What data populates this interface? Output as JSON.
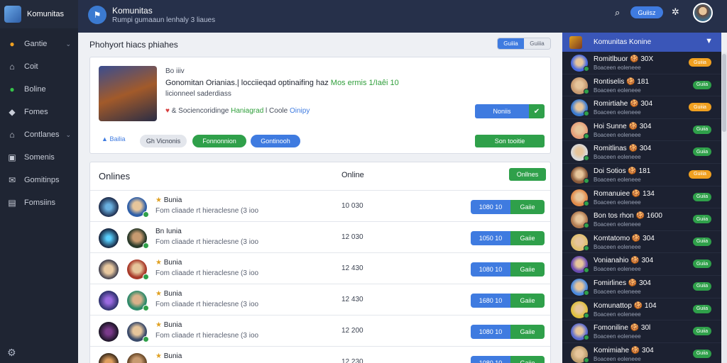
{
  "sidebar": {
    "brand": "Komunitas",
    "items": [
      {
        "label": "Gantie",
        "icon": "coin-icon",
        "chev": true,
        "active": false
      },
      {
        "label": "Coit",
        "icon": "home-icon",
        "chev": false,
        "active": false
      },
      {
        "label": "Boline",
        "icon": "chat-bubble-icon",
        "chev": false,
        "active": true
      },
      {
        "label": "Fomes",
        "icon": "tag-icon",
        "chev": false,
        "active": false
      },
      {
        "label": "Contlanes",
        "icon": "house-icon",
        "chev": true,
        "active": false
      },
      {
        "label": "Somenis",
        "icon": "image-icon",
        "chev": false,
        "active": false
      },
      {
        "label": "Gomitinps",
        "icon": "mail-icon",
        "chev": false,
        "active": false
      },
      {
        "label": "Fomsiins",
        "icon": "document-icon",
        "chev": false,
        "active": false
      }
    ]
  },
  "header": {
    "title": "Komunitas",
    "subtitle": "Rumpi gumaaun lenhaly 3 liaues",
    "button_label": "Guiisz"
  },
  "main": {
    "title": "Phohyort hiacs phiahes",
    "segments": [
      "Guiiia",
      "Guiiia"
    ],
    "featured": {
      "kicker": "Bo iiiv",
      "headline_a": "Gonomitan Orianias.| locciieqad optinaifing haz",
      "headline_b": "Mos ermis 1/Iaêi 10",
      "subtitle": "licionneel saderdiass",
      "meta_a": "& Sociencoridinge",
      "meta_b": "Haniagrad",
      "meta_c": "l Coole",
      "meta_d": "Oinipy",
      "split_label": "Noniis",
      "link": "Bailia",
      "pill_gray": "Gh Vicnonis",
      "pill_green": "Fonnonnion",
      "pill_blue": "Gontinooh",
      "cta": "Son tooitie"
    },
    "list": {
      "title": "Onlines",
      "column": "Online",
      "button": "Onllnes",
      "rows": [
        {
          "name": "Bunia",
          "star": true,
          "desc": "Fom cliaade rt hieraclesne (3 ioo",
          "value": "10 030",
          "btn_a": "1080 10",
          "btn_b": "Gaiie"
        },
        {
          "name": "Bn Iunia",
          "star": false,
          "desc": "Fom cliaade rt hieraclesne (3 ioo",
          "value": "12 030",
          "btn_a": "1050 10",
          "btn_b": "Gaiie"
        },
        {
          "name": "Bunia",
          "star": true,
          "desc": "Fom cliaade rt hieraclesne (3 ioo",
          "value": "12 430",
          "btn_a": "1080 10",
          "btn_b": "Gaiie"
        },
        {
          "name": "Bunia",
          "star": true,
          "desc": "Fom cliaade rt hieraclesne (3 ioo",
          "value": "12 430",
          "btn_a": "1680 10",
          "btn_b": "Gaiie"
        },
        {
          "name": "Bunia",
          "star": true,
          "desc": "Fom cliaade rt hieraclesne (3 ioo",
          "value": "12 200",
          "btn_a": "1080 10",
          "btn_b": "Gaiie"
        },
        {
          "name": "Bunia",
          "star": true,
          "desc": "Fom cliaade rt hieraclesne (3 ioo",
          "value": "12 230",
          "btn_a": "1080 10",
          "btn_b": "Gaiie"
        }
      ]
    }
  },
  "panel": {
    "title": "Komunitas Konine",
    "items": [
      {
        "name": "Romitlbuor 🍪 30X",
        "sub": "Boaceen eoleneee",
        "badge": "Guiiia",
        "badge_color": "orange"
      },
      {
        "name": "Rontiselis 🍪 181",
        "sub": "Boaceen eoleneee",
        "badge": "Guiia",
        "badge_color": "green"
      },
      {
        "name": "Romirtiahe 🍪 304",
        "sub": "Boaceen eoleneee",
        "badge": "Guiiia",
        "badge_color": "orange"
      },
      {
        "name": "Hoi Sunne 🍪 304",
        "sub": "Boaceen eoleneee",
        "badge": "Guiia",
        "badge_color": "green"
      },
      {
        "name": "Romitlinas 🍪 304",
        "sub": "Boaceen eoleneee",
        "badge": "Guiia",
        "badge_color": "green"
      },
      {
        "name": "Doi Sotios 🍪 181",
        "sub": "Boaceen eoleneee",
        "badge": "Guiiia",
        "badge_color": "orange"
      },
      {
        "name": "Romanuiee 🍪 134",
        "sub": "Boaceen eoleneee",
        "badge": "Guiia",
        "badge_color": "green"
      },
      {
        "name": "Bon tos rhon 🍪 1600",
        "sub": "Boaceen eoleneee",
        "badge": "Guiia",
        "badge_color": "green"
      },
      {
        "name": "Komtatomo 🍪 304",
        "sub": "Boaceen eoleneee",
        "badge": "Guiia",
        "badge_color": "green"
      },
      {
        "name": "Vonianahio 🍪 304",
        "sub": "Boaceen eoleneee",
        "badge": "Guiia",
        "badge_color": "green"
      },
      {
        "name": "Fomirlines 🍪 304",
        "sub": "Boaceen eoleneee",
        "badge": "Guiia",
        "badge_color": "green"
      },
      {
        "name": "Komunattop 🍪 104",
        "sub": "Boaceen eoleneee",
        "badge": "Guiia",
        "badge_color": "green"
      },
      {
        "name": "Fomoniline 🍪 30l",
        "sub": "Boaceen eoleneee",
        "badge": "Guiia",
        "badge_color": "green"
      },
      {
        "name": "Komimiahe 🍪 304",
        "sub": "Boaceen eoleneee",
        "badge": "Guiia",
        "badge_color": "green"
      }
    ]
  },
  "colors": {
    "sidebar_bg": "#1f2533",
    "header_bg": "#26304a",
    "accent_blue": "#3f7be0",
    "accent_green": "#2fa04a",
    "accent_orange": "#f0a020",
    "panel_header": "#3a56b8"
  }
}
